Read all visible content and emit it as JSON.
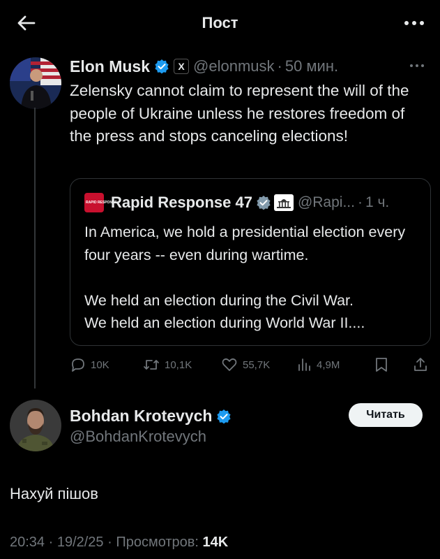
{
  "header": {
    "title": "Пост"
  },
  "main_tweet": {
    "author_name": "Elon Musk",
    "affiliate_badge": "X",
    "handle": "@elonmusk",
    "separator": "·",
    "time": "50 мин.",
    "text": "Zelensky cannot claim to represent the will of the people of Ukraine unless he restores freedom of the press and stops canceling elections!",
    "quote": {
      "author_name": "Rapid Response 47",
      "avatar_text": "RAPID RESPONSE",
      "handle": "@Rapi...",
      "separator": "·",
      "time": "1 ч.",
      "text": "In America, we hold a presidential election every four years -- even during wartime.\n\nWe held an election during the Civil War.\nWe held an election during World War II...."
    },
    "actions": {
      "replies": "10K",
      "reposts": "10,1K",
      "likes": "55,7K",
      "views": "4,9M"
    }
  },
  "reply_tweet": {
    "author_name": "Bohdan Krotevych",
    "handle": "@BohdanKrotevych",
    "follow_label": "Читать",
    "text": "Нахуй пішов",
    "timestamp": "20:34 · 19/2/25 · Просмотров: ",
    "views": "14K"
  },
  "colors": {
    "background": "#000000",
    "text": "#e7e9ea",
    "muted": "#71767b",
    "verified": "#1d9bf0",
    "border": "#2f3336"
  },
  "icons": [
    "back-arrow-icon",
    "more-icon",
    "verified-icon",
    "x-logo-icon",
    "government-badge-icon",
    "reply-icon",
    "repost-icon",
    "like-icon",
    "views-icon",
    "bookmark-icon",
    "share-icon"
  ]
}
